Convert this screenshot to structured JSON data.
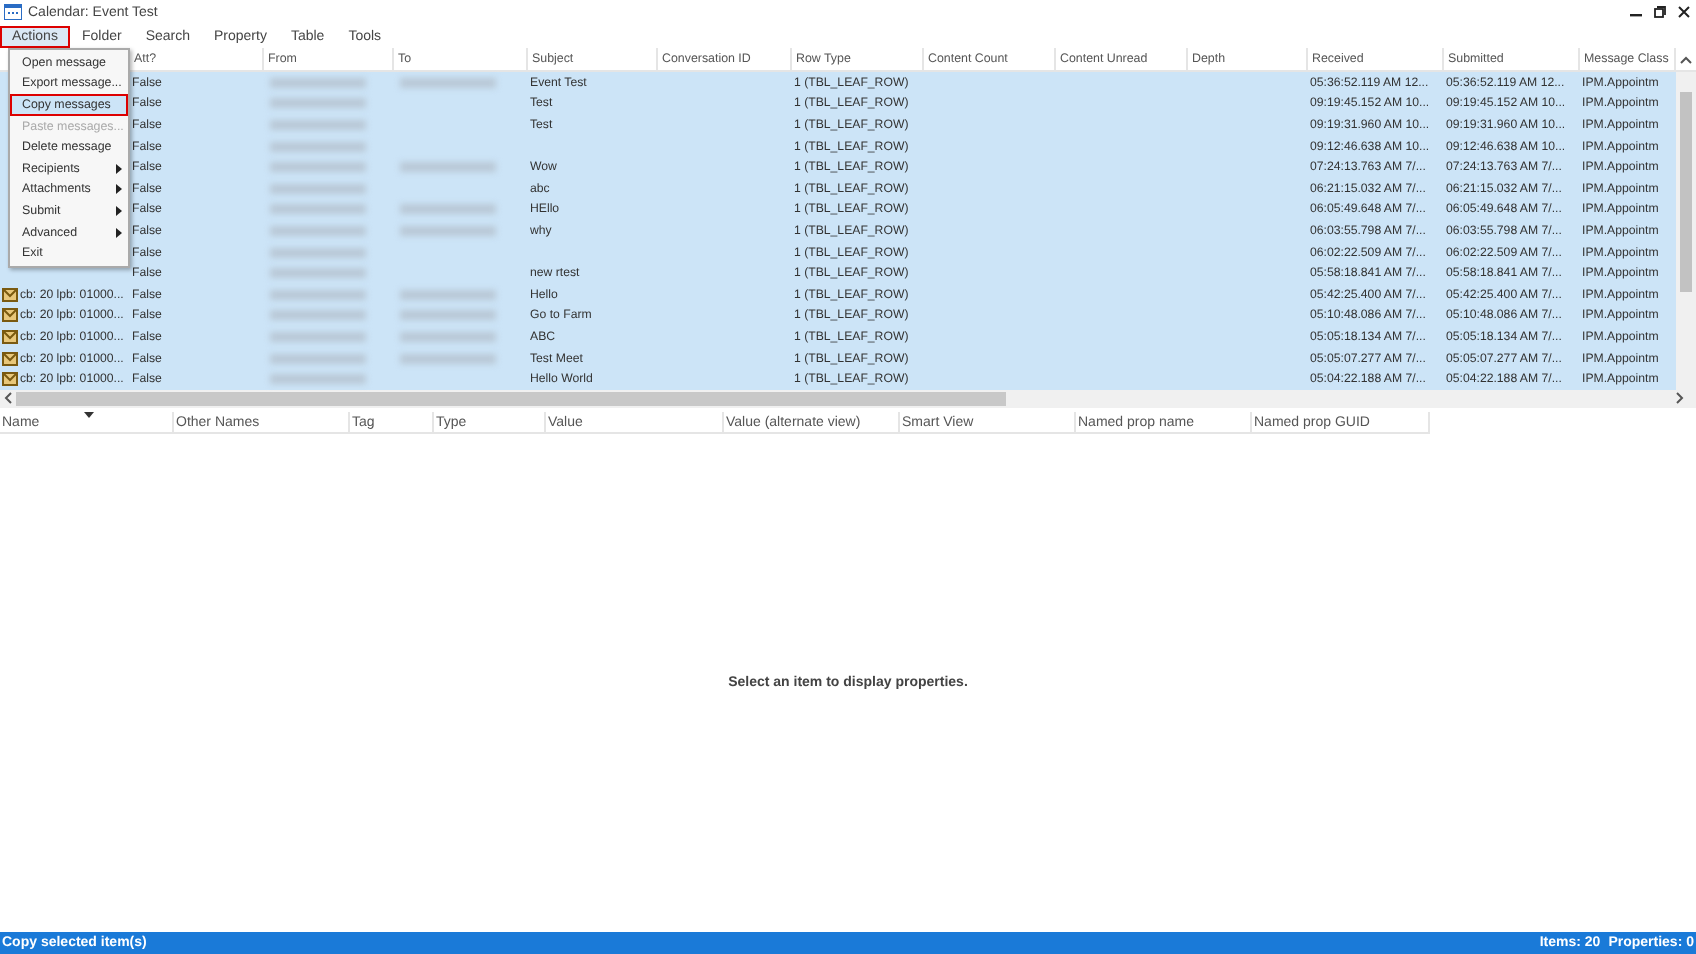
{
  "window": {
    "title": "Calendar: Event Test"
  },
  "menu_bar": [
    {
      "label": "Actions",
      "selected": true
    },
    {
      "label": "Folder",
      "selected": false
    },
    {
      "label": "Search",
      "selected": false
    },
    {
      "label": "Property",
      "selected": false
    },
    {
      "label": "Table",
      "selected": false
    },
    {
      "label": "Tools",
      "selected": false
    }
  ],
  "actions_menu": [
    {
      "label": "Open message",
      "selected": false,
      "disabled": false,
      "submenu": false
    },
    {
      "label": "Export message...",
      "selected": false,
      "disabled": false,
      "submenu": false
    },
    {
      "label": "Copy messages",
      "selected": true,
      "disabled": false,
      "submenu": false
    },
    {
      "label": "Paste messages...",
      "selected": false,
      "disabled": true,
      "submenu": false
    },
    {
      "label": "Delete message",
      "selected": false,
      "disabled": false,
      "submenu": false
    },
    {
      "label": "Recipients",
      "selected": false,
      "disabled": false,
      "submenu": true
    },
    {
      "label": "Attachments",
      "selected": false,
      "disabled": false,
      "submenu": true
    },
    {
      "label": "Submit",
      "selected": false,
      "disabled": false,
      "submenu": true
    },
    {
      "label": "Advanced",
      "selected": false,
      "disabled": false,
      "submenu": true
    },
    {
      "label": "Exit",
      "selected": false,
      "disabled": false,
      "submenu": false
    }
  ],
  "table": {
    "columns": [
      "Att?",
      "From",
      "To",
      "Subject",
      "Conversation ID",
      "Row Type",
      "Content Count",
      "Content Unread",
      "Depth",
      "Received",
      "Submitted",
      "Message Class"
    ],
    "rows": [
      {
        "selected": true,
        "att": "False",
        "to_blurred": true,
        "subject": "Event Test",
        "row_type": "1 (TBL_LEAF_ROW)",
        "received": "05:36:52.119 AM 12...",
        "submitted": "05:36:52.119 AM 12...",
        "message_class": "IPM.Appointm"
      },
      {
        "selected": true,
        "att": "False",
        "to_blurred": false,
        "subject": "Test",
        "row_type": "1 (TBL_LEAF_ROW)",
        "received": "09:19:45.152 AM 10...",
        "submitted": "09:19:45.152 AM 10...",
        "message_class": "IPM.Appointm"
      },
      {
        "selected": true,
        "att": "False",
        "to_blurred": false,
        "subject": "Test",
        "row_type": "1 (TBL_LEAF_ROW)",
        "received": "09:19:31.960 AM 10...",
        "submitted": "09:19:31.960 AM 10...",
        "message_class": "IPM.Appointm"
      },
      {
        "selected": true,
        "att": "False",
        "to_blurred": false,
        "row_type": "1 (TBL_LEAF_ROW)",
        "received": "09:12:46.638 AM 10...",
        "submitted": "09:12:46.638 AM 10...",
        "message_class": "IPM.Appointm"
      },
      {
        "selected": true,
        "att": "False",
        "to_blurred": true,
        "subject": "Wow",
        "row_type": "1 (TBL_LEAF_ROW)",
        "received": "07:24:13.763 AM 7/...",
        "submitted": "07:24:13.763 AM 7/...",
        "message_class": "IPM.Appointm"
      },
      {
        "selected": true,
        "att": "False",
        "to_blurred": false,
        "subject": "abc",
        "row_type": "1 (TBL_LEAF_ROW)",
        "received": "06:21:15.032 AM 7/...",
        "submitted": "06:21:15.032 AM 7/...",
        "message_class": "IPM.Appointm"
      },
      {
        "selected": true,
        "att": "False",
        "to_blurred": true,
        "subject": "HEllo",
        "row_type": "1 (TBL_LEAF_ROW)",
        "received": "06:05:49.648 AM 7/...",
        "submitted": "06:05:49.648 AM 7/...",
        "message_class": "IPM.Appointm"
      },
      {
        "selected": true,
        "att": "False",
        "to_blurred": true,
        "subject": "why",
        "row_type": "1 (TBL_LEAF_ROW)",
        "received": "06:03:55.798 AM 7/...",
        "submitted": "06:03:55.798 AM 7/...",
        "message_class": "IPM.Appointm"
      },
      {
        "selected": true,
        "att": "False",
        "to_blurred": false,
        "row_type": "1 (TBL_LEAF_ROW)",
        "received": "06:02:22.509 AM 7/...",
        "submitted": "06:02:22.509 AM 7/...",
        "message_class": "IPM.Appointm"
      },
      {
        "selected": true,
        "att": "False",
        "to_blurred": false,
        "subject": "new rtest",
        "row_type": "1 (TBL_LEAF_ROW)",
        "received": "05:58:18.841 AM 7/...",
        "submitted": "05:58:18.841 AM 7/...",
        "message_class": "IPM.Appointm"
      },
      {
        "selected": true,
        "instance_key": "cb: 20 lpb: 01000...",
        "att": "False",
        "to_blurred": true,
        "subject": "Hello",
        "row_type": "1 (TBL_LEAF_ROW)",
        "received": "05:42:25.400 AM 7/...",
        "submitted": "05:42:25.400 AM 7/...",
        "message_class": "IPM.Appointm"
      },
      {
        "selected": true,
        "instance_key": "cb: 20 lpb: 01000...",
        "att": "False",
        "to_blurred": true,
        "subject": "Go to Farm",
        "row_type": "1 (TBL_LEAF_ROW)",
        "received": "05:10:48.086 AM 7/...",
        "submitted": "05:10:48.086 AM 7/...",
        "message_class": "IPM.Appointm"
      },
      {
        "selected": true,
        "instance_key": "cb: 20 lpb: 01000...",
        "att": "False",
        "to_blurred": true,
        "subject": "ABC",
        "row_type": "1 (TBL_LEAF_ROW)",
        "received": "05:05:18.134 AM 7/...",
        "submitted": "05:05:18.134 AM 7/...",
        "message_class": "IPM.Appointm"
      },
      {
        "selected": true,
        "instance_key": "cb: 20 lpb: 01000...",
        "att": "False",
        "to_blurred": true,
        "subject": "Test Meet",
        "row_type": "1 (TBL_LEAF_ROW)",
        "received": "05:05:07.277 AM 7/...",
        "submitted": "05:05:07.277 AM 7/...",
        "message_class": "IPM.Appointm"
      },
      {
        "selected": true,
        "instance_key": "cb: 20 lpb: 01000...",
        "att": "False",
        "to_blurred": false,
        "subject": "Hello World",
        "row_type": "1 (TBL_LEAF_ROW)",
        "received": "05:04:22.188 AM 7/...",
        "submitted": "05:04:22.188 AM 7/...",
        "message_class": "IPM.Appointm"
      }
    ]
  },
  "properties": {
    "columns": [
      "Name",
      "Other Names",
      "Tag",
      "Type",
      "Value",
      "Value (alternate view)",
      "Smart View",
      "Named prop name",
      "Named prop GUID"
    ],
    "empty_message": "Select an item to display properties."
  },
  "status_bar": {
    "message": "Copy selected item(s)",
    "items": "Items: 20",
    "properties": "Properties: 0"
  }
}
